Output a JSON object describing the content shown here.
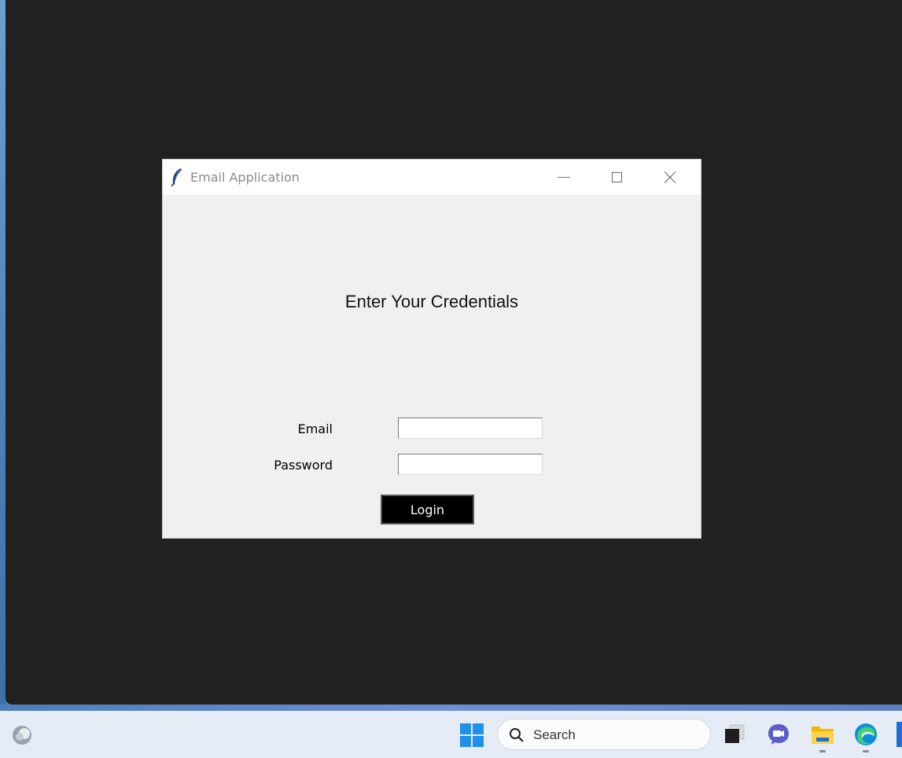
{
  "window": {
    "title": "Email Application",
    "controls": [
      "minimize",
      "maximize",
      "close"
    ]
  },
  "form": {
    "heading": "Enter Your Credentials",
    "email_label": "Email",
    "email_value": "",
    "password_label": "Password",
    "password_value": "",
    "login_label": "Login"
  },
  "taskbar": {
    "search_placeholder": "Search",
    "icons": [
      "widgets-icon",
      "windows-start-icon",
      "search-icon",
      "task-view-icon",
      "meet-icon",
      "file-explorer-icon",
      "edge-icon"
    ]
  },
  "colors": {
    "accent_button": "#000000",
    "window_bg": "#f0f0f0",
    "desktop_dark": "#212121",
    "taskbar_bg": "#e6ecf5"
  }
}
